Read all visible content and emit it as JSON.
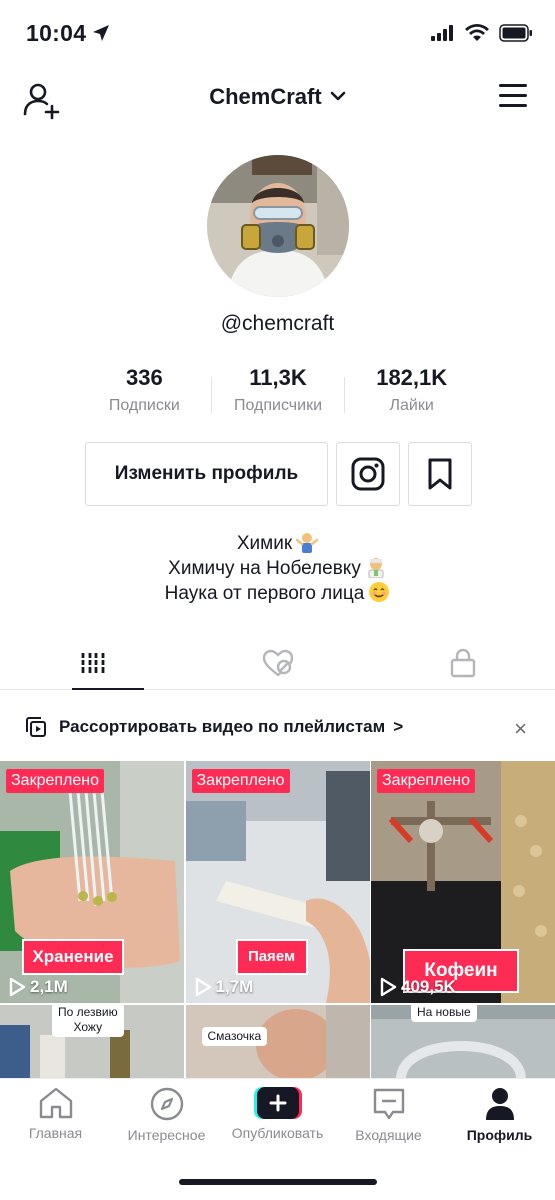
{
  "status_bar": {
    "time": "10:04"
  },
  "header": {
    "username_title": "ChemCraft"
  },
  "profile": {
    "handle": "@chemcraft",
    "stats": [
      {
        "value": "336",
        "label": "Подписки"
      },
      {
        "value": "11,3K",
        "label": "Подписчики"
      },
      {
        "value": "182,1K",
        "label": "Лайки"
      }
    ],
    "edit_label": "Изменить профиль",
    "bio": [
      "Химик",
      "Химичу на Нобелевку",
      "Наука от первого лица"
    ]
  },
  "playlist_banner": {
    "text": "Рассортировать видео по плейлистам",
    "chevron": ">",
    "close": "×"
  },
  "videos": [
    {
      "pinned_label": "Закреплено",
      "overlay": "Хранение",
      "views": "2,1M"
    },
    {
      "pinned_label": "Закреплено",
      "overlay": "Паяем",
      "views": "1,7M"
    },
    {
      "pinned_label": "Закреплено",
      "overlay": "Кофеин",
      "views": "409,5K"
    },
    {
      "sticker": "По лезвию\nХожу"
    },
    {
      "sticker": "Смазочка"
    },
    {
      "sticker": "На новые"
    }
  ],
  "bottom_nav": [
    {
      "label": "Главная",
      "icon": "home-icon"
    },
    {
      "label": "Интересное",
      "icon": "compass-icon"
    },
    {
      "label": "Опубликовать",
      "icon": "plus-icon"
    },
    {
      "label": "Входящие",
      "icon": "inbox-icon"
    },
    {
      "label": "Профиль",
      "icon": "profile-icon"
    }
  ],
  "colors": {
    "accent": "#fe2c55",
    "text": "#161823",
    "muted": "#8a8b91"
  }
}
